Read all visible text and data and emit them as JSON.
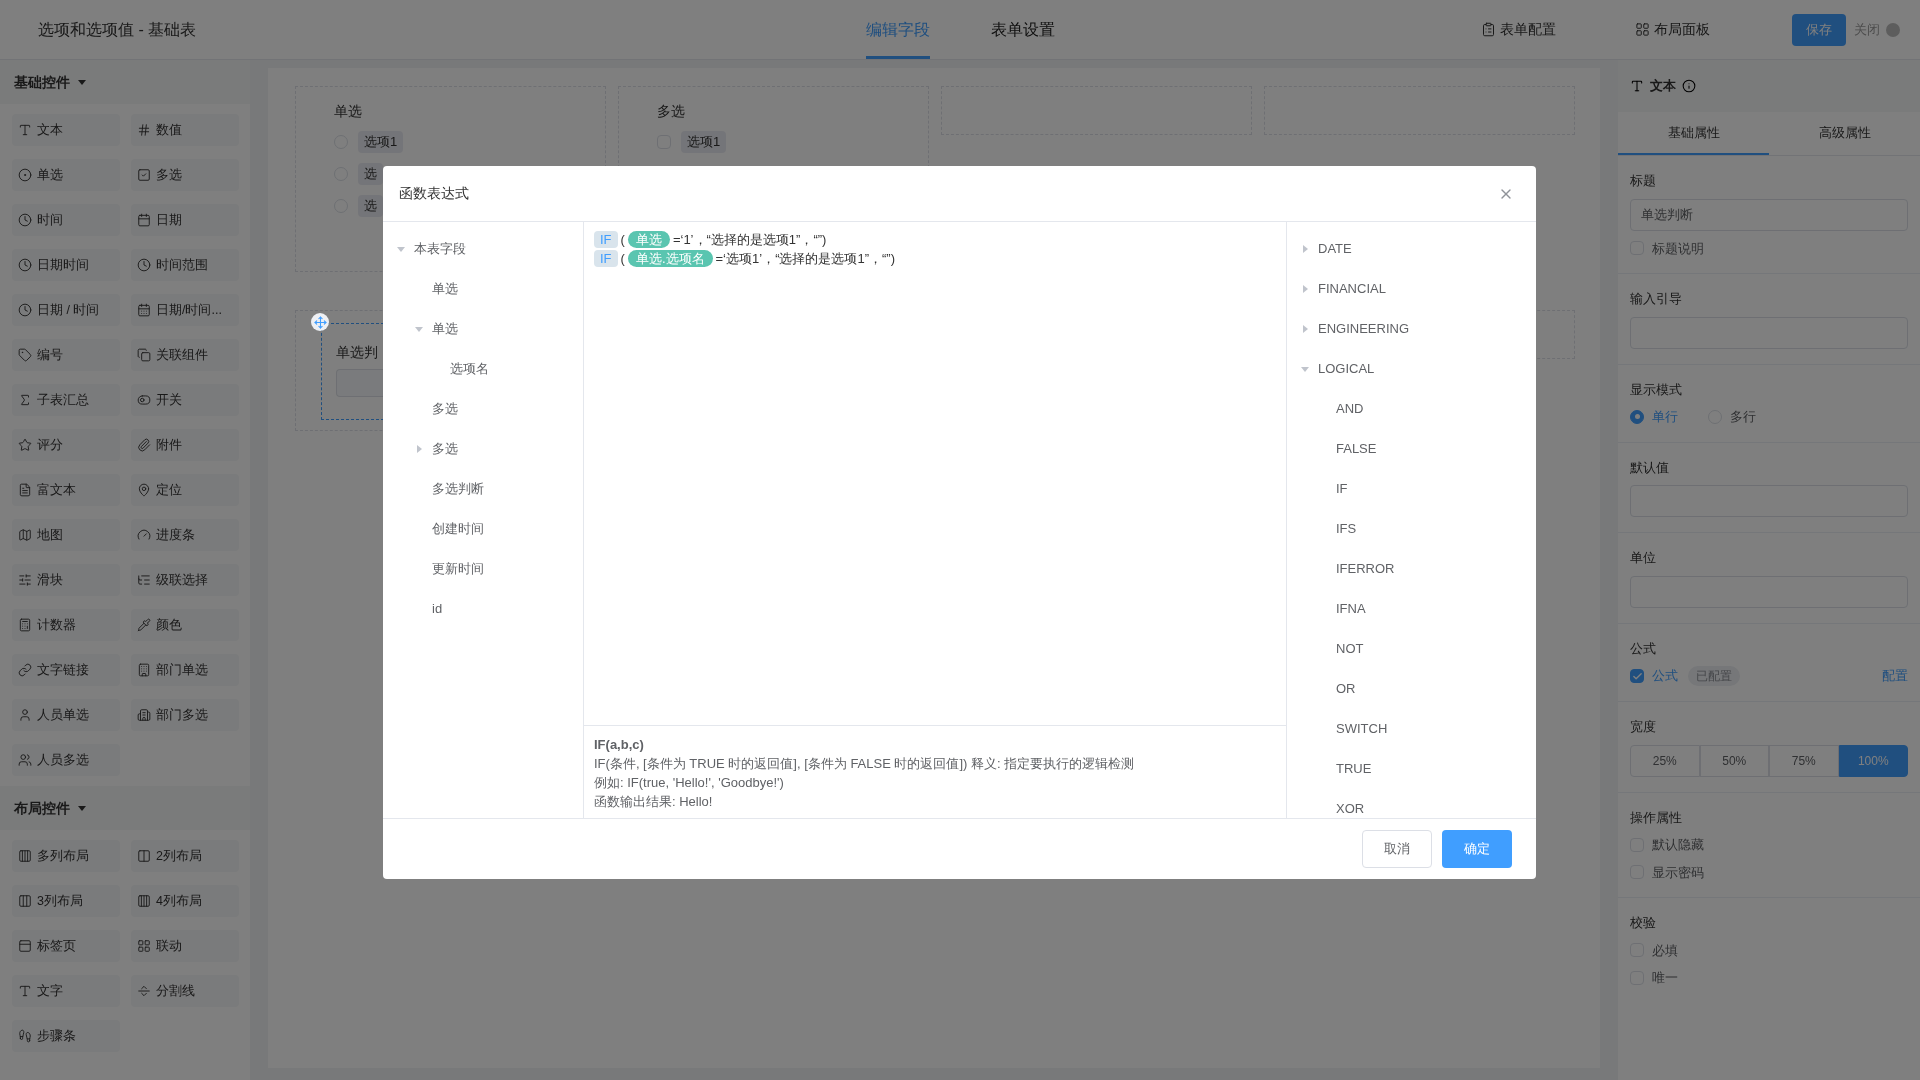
{
  "header": {
    "title": "选项和选项值 - 基础表",
    "tabs": [
      {
        "label": "编辑字段",
        "selected": true
      },
      {
        "label": "表单设置",
        "selected": false
      }
    ],
    "actions": [
      {
        "kind": "icon-link",
        "label": "表单配置"
      },
      {
        "kind": "icon-link",
        "label": "布局面板"
      },
      {
        "kind": "primary",
        "label": "保存"
      },
      {
        "kind": "close",
        "label": "关闭"
      }
    ]
  },
  "sidebar": {
    "sections": [
      {
        "title": "基础控件",
        "expanded": true,
        "items": [
          "文本",
          "数值",
          "单选",
          "多选",
          "时间",
          "日期",
          "日期时间",
          "时间范围",
          "日期 / 时间",
          "日期/时间...",
          "编号",
          "关联组件",
          "子表汇总",
          "开关",
          "评分",
          "附件",
          "富文本",
          "定位",
          "地图",
          "进度条",
          "滑块",
          "级联选择",
          "计数器",
          "颜色",
          "文字链接",
          "部门单选",
          "人员单选",
          "部门多选",
          "人员多选"
        ]
      },
      {
        "title": "布局控件",
        "expanded": true,
        "items": [
          "多列布局",
          "2列布局",
          "3列布局",
          "4列布局",
          "标签页",
          "联动",
          "文字",
          "分割线",
          "步骤条"
        ]
      }
    ]
  },
  "canvas": {
    "rows": [
      [
        {
          "kind": "radio",
          "label": "单选",
          "options": [
            {
              "label": "选项1",
              "selected": false
            },
            {
              "label": "选",
              "selected": false
            },
            {
              "label": "选",
              "selected": false
            }
          ]
        },
        {
          "kind": "checkbox",
          "label": "多选",
          "options": [
            {
              "label": "选项1",
              "checked": false
            }
          ]
        },
        {
          "kind": "empty"
        },
        {
          "kind": "empty"
        }
      ],
      [
        {
          "kind": "field",
          "label": "单选判",
          "selected": true
        },
        {
          "kind": "empty"
        }
      ]
    ]
  },
  "properties": {
    "title": "文本",
    "tabs": [
      {
        "label": "基础属性",
        "selected": true
      },
      {
        "label": "高级属性",
        "selected": false
      }
    ],
    "sections": [
      {
        "label": "标题",
        "controls": [
          {
            "kind": "input",
            "value": "单选判断"
          },
          {
            "kind": "checkbox",
            "label": "标题说明",
            "checked": false
          }
        ]
      },
      {
        "label": "输入引导",
        "controls": [
          {
            "kind": "input"
          }
        ]
      },
      {
        "label": "显示模式",
        "controls": [
          {
            "kind": "radio-group",
            "options": [
              {
                "label": "单行",
                "selected": true
              },
              {
                "label": "多行",
                "selected": false
              }
            ]
          }
        ]
      },
      {
        "label": "默认值",
        "controls": [
          {
            "kind": "input"
          }
        ]
      },
      {
        "label": "单位",
        "controls": [
          {
            "kind": "input"
          }
        ]
      },
      {
        "label": "公式",
        "controls": [
          {
            "kind": "formula",
            "label": "公式",
            "checked": true,
            "badge": "已配置",
            "link": "配置"
          }
        ]
      },
      {
        "label": "宽度",
        "controls": [
          {
            "kind": "segmented",
            "options": [
              {
                "label": "25%",
                "selected": false
              },
              {
                "label": "50%",
                "selected": false
              },
              {
                "label": "75%",
                "selected": false
              },
              {
                "label": "100%",
                "selected": true
              }
            ]
          }
        ]
      },
      {
        "label": "操作属性",
        "controls": [
          {
            "kind": "checkbox",
            "label": "默认隐藏",
            "checked": false
          },
          {
            "kind": "checkbox",
            "label": "显示密码",
            "checked": false
          }
        ]
      },
      {
        "label": "校验",
        "controls": [
          {
            "kind": "checkbox",
            "label": "必填",
            "checked": false
          },
          {
            "kind": "checkbox",
            "label": "唯一",
            "checked": false
          }
        ]
      }
    ]
  },
  "dialog": {
    "title": "函数表达式",
    "fields": [
      {
        "label": "本表字段",
        "expanded": true,
        "children": [
          {
            "label": "单选"
          },
          {
            "label": "单选",
            "expanded": true,
            "children": [
              {
                "label": "选项名"
              }
            ]
          },
          {
            "label": "多选"
          },
          {
            "label": "多选",
            "expanded": false
          },
          {
            "label": "多选判断"
          },
          {
            "label": "创建时间"
          },
          {
            "label": "更新时间"
          },
          {
            "label": "id"
          }
        ]
      }
    ],
    "expression": [
      [
        {
          "kind": "function",
          "text": "IF"
        },
        {
          "kind": "text",
          "text": "("
        },
        {
          "kind": "field",
          "text": "单选"
        },
        {
          "kind": "text",
          "text": "=‘1’，“选择的是选项1”，“”)"
        }
      ],
      [
        {
          "kind": "function",
          "text": "IF"
        },
        {
          "kind": "text",
          "text": "("
        },
        {
          "kind": "field",
          "text": "单选.选项名"
        },
        {
          "kind": "text",
          "text": "=‘选项1’，“选择的是选项1”，“”)"
        }
      ]
    ],
    "help": {
      "signature": "IF(a,b,c)",
      "lines": [
        "IF(条件, [条件为 TRUE 时的返回值], [条件为 FALSE 时的返回值]) 释义: 指定要执行的逻辑检测",
        "例如: IF(true, 'Hello!', 'Goodbye!')",
        "函数输出结果: Hello!"
      ]
    },
    "functions": [
      {
        "label": "DATE",
        "expanded": false
      },
      {
        "label": "FINANCIAL",
        "expanded": false
      },
      {
        "label": "ENGINEERING",
        "expanded": false
      },
      {
        "label": "LOGICAL",
        "expanded": true,
        "children": [
          {
            "label": "AND"
          },
          {
            "label": "FALSE"
          },
          {
            "label": "IF"
          },
          {
            "label": "IFS"
          },
          {
            "label": "IFERROR"
          },
          {
            "label": "IFNA"
          },
          {
            "label": "NOT"
          },
          {
            "label": "OR"
          },
          {
            "label": "SWITCH"
          },
          {
            "label": "TRUE"
          },
          {
            "label": "XOR"
          }
        ]
      }
    ],
    "buttons": [
      {
        "kind": "secondary",
        "label": "取消"
      },
      {
        "kind": "primary",
        "label": "确定"
      }
    ]
  }
}
